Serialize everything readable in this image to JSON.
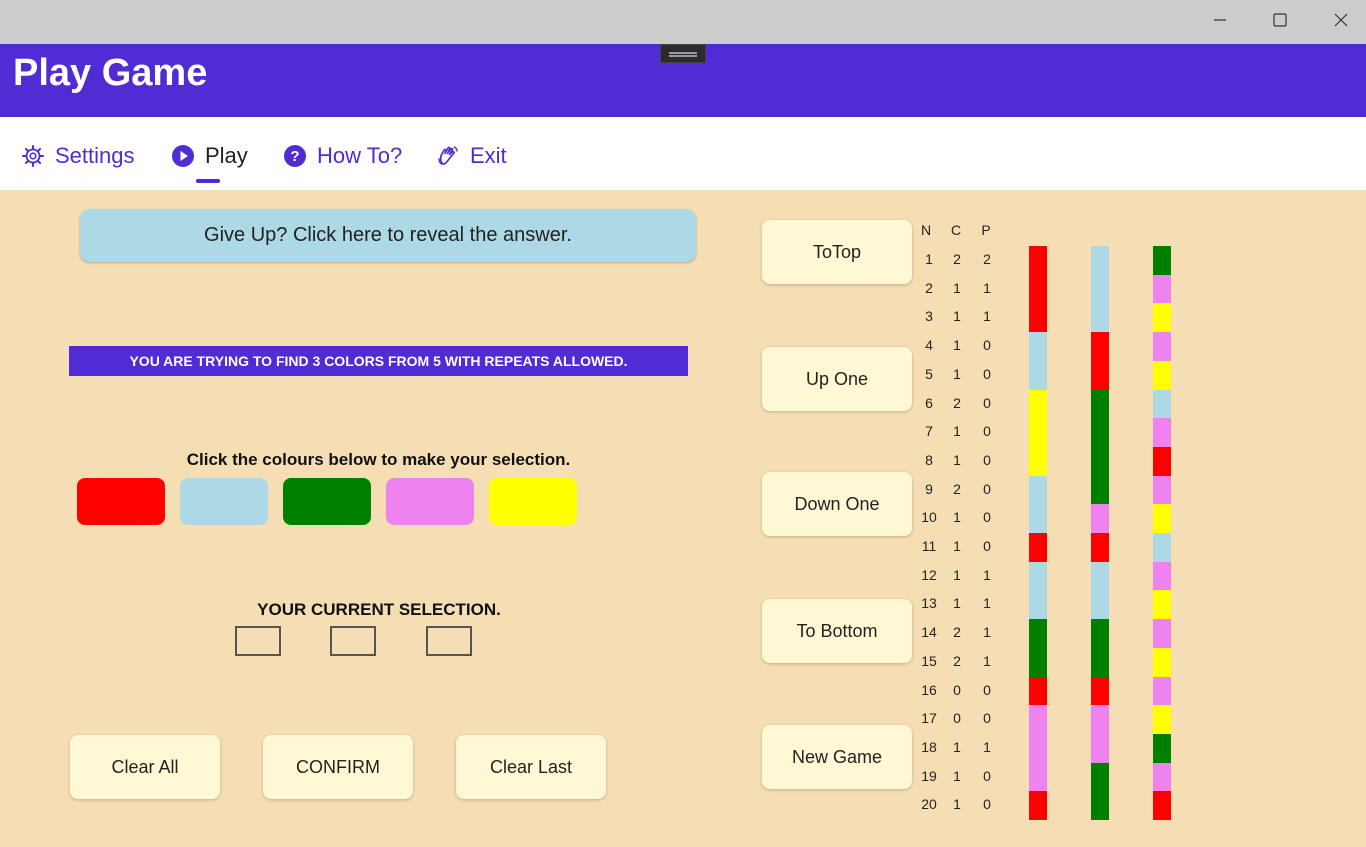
{
  "window": {
    "minimize_glyph": "—",
    "maximize_glyph": "☐",
    "close_glyph": "✕"
  },
  "header": {
    "title": "Play Game"
  },
  "nav": {
    "tabs": [
      {
        "label": "Settings",
        "icon": "gear-icon"
      },
      {
        "label": "Play",
        "icon": "play-icon",
        "active": true
      },
      {
        "label": "How To?",
        "icon": "question-icon"
      },
      {
        "label": "Exit",
        "icon": "wave-hand-icon"
      }
    ]
  },
  "game": {
    "give_up_label": "Give Up?  Click here to reveal the answer.",
    "banner": "YOU ARE TRYING TO FIND 3 COLORS FROM 5 WITH REPEATS ALLOWED.",
    "palette_instruction": "Click the colours below to make your selection.",
    "palette": [
      "#ff0000",
      "#add8e6",
      "#008000",
      "#ee82ee",
      "#ffff00"
    ],
    "current_selection_label": "YOUR CURRENT SELECTION.",
    "selection": [
      null,
      null,
      null
    ],
    "clear_all_label": "Clear All",
    "confirm_label": "CONFIRM",
    "clear_last_label": "Clear Last"
  },
  "scroll": {
    "to_top_label": "ToTop",
    "up_one_label": "Up One",
    "down_one_label": "Down One",
    "to_bottom_label": "To Bottom",
    "new_game_label": "New Game"
  },
  "colors": {
    "accent": "#512bd4",
    "background": "#f5deb3",
    "button_bg": "#fff8d4",
    "give_up_bg": "#add8e6"
  },
  "history": {
    "headers": [
      "N",
      "C",
      "P"
    ],
    "rows": [
      {
        "n": "1",
        "c": "2",
        "p": "2",
        "colors": [
          "red",
          "lightblue",
          "green"
        ]
      },
      {
        "n": "2",
        "c": "1",
        "p": "1",
        "colors": [
          "red",
          "lightblue",
          "violet"
        ]
      },
      {
        "n": "3",
        "c": "1",
        "p": "1",
        "colors": [
          "red",
          "lightblue",
          "yellow"
        ]
      },
      {
        "n": "4",
        "c": "1",
        "p": "0",
        "colors": [
          "lightblue",
          "red",
          "violet"
        ]
      },
      {
        "n": "5",
        "c": "1",
        "p": "0",
        "colors": [
          "lightblue",
          "red",
          "yellow"
        ]
      },
      {
        "n": "6",
        "c": "2",
        "p": "0",
        "colors": [
          "yellow",
          "green",
          "lightblue"
        ]
      },
      {
        "n": "7",
        "c": "1",
        "p": "0",
        "colors": [
          "yellow",
          "green",
          "violet"
        ]
      },
      {
        "n": "8",
        "c": "1",
        "p": "0",
        "colors": [
          "yellow",
          "green",
          "red"
        ]
      },
      {
        "n": "9",
        "c": "2",
        "p": "0",
        "colors": [
          "lightblue",
          "green",
          "violet"
        ]
      },
      {
        "n": "10",
        "c": "1",
        "p": "0",
        "colors": [
          "lightblue",
          "violet",
          "yellow"
        ]
      },
      {
        "n": "11",
        "c": "1",
        "p": "0",
        "colors": [
          "red",
          "red",
          "lightblue"
        ]
      },
      {
        "n": "12",
        "c": "1",
        "p": "1",
        "colors": [
          "lightblue",
          "lightblue",
          "violet"
        ]
      },
      {
        "n": "13",
        "c": "1",
        "p": "1",
        "colors": [
          "lightblue",
          "lightblue",
          "yellow"
        ]
      },
      {
        "n": "14",
        "c": "2",
        "p": "1",
        "colors": [
          "green",
          "green",
          "violet"
        ]
      },
      {
        "n": "15",
        "c": "2",
        "p": "1",
        "colors": [
          "green",
          "green",
          "yellow"
        ]
      },
      {
        "n": "16",
        "c": "0",
        "p": "0",
        "colors": [
          "red",
          "red",
          "violet"
        ]
      },
      {
        "n": "17",
        "c": "0",
        "p": "0",
        "colors": [
          "violet",
          "violet",
          "yellow"
        ]
      },
      {
        "n": "18",
        "c": "1",
        "p": "1",
        "colors": [
          "violet",
          "violet",
          "green"
        ]
      },
      {
        "n": "19",
        "c": "1",
        "p": "0",
        "colors": [
          "violet",
          "green",
          "violet"
        ]
      },
      {
        "n": "20",
        "c": "1",
        "p": "0",
        "colors": [
          "red",
          "green",
          "red"
        ]
      }
    ]
  }
}
